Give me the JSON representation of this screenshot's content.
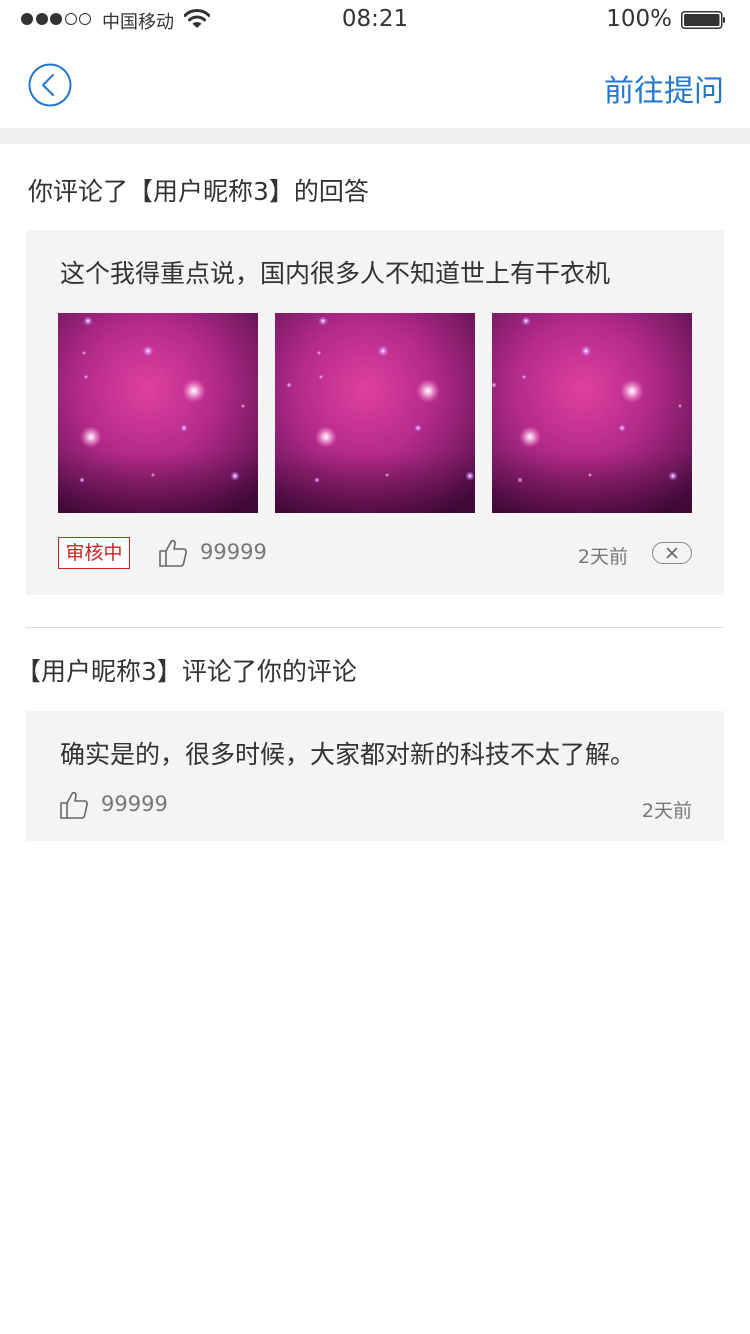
{
  "status_bar": {
    "carrier": "中国移动",
    "time": "08:21",
    "battery": "100%",
    "signal_bars_filled": 3,
    "signal_bars_total": 5
  },
  "nav": {
    "back_icon": "chevron-left-circle",
    "ask_label": "前往提问",
    "accent_color": "#2277d0"
  },
  "items": [
    {
      "title": "你评论了【用户昵称3】的回答",
      "text": "这个我得重点说，国内很多人不知道世上有干衣机",
      "images": [
        "galaxy-pink-1",
        "galaxy-pink-2",
        "galaxy-pink-3"
      ],
      "status": "审核中",
      "likes": "99999",
      "time": "2天前",
      "close_icon": "close-icon"
    },
    {
      "title": "【用户昵称3】评论了你的评论",
      "text": "确实是的，很多时候，大家都对新的科技不太了解。",
      "likes": "99999",
      "time": "2天前"
    }
  ]
}
